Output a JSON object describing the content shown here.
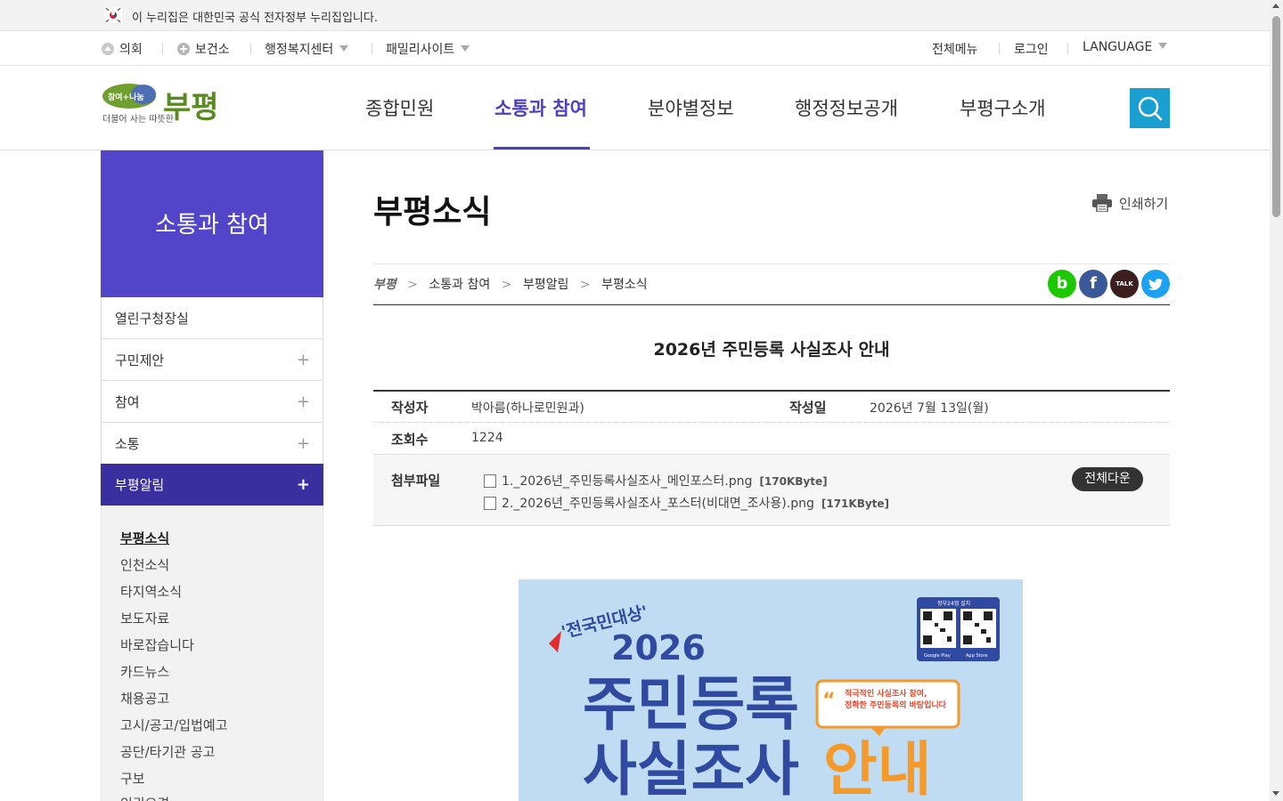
{
  "gov_banner": {
    "text": "이 누리집은 대한민국 공식 전자정부 누리집입니다."
  },
  "utility": {
    "left": [
      "의회",
      "보건소",
      "행정복지센터",
      "패밀리사이트"
    ],
    "right": [
      "전체메뉴",
      "로그인",
      "LANGUAGE"
    ]
  },
  "logo": {
    "tagline_top": "참여+나눔",
    "tagline_bottom": "더불어 사는 따뜻한",
    "name": "부평"
  },
  "gnb": [
    "종합민원",
    "소통과 참여",
    "분야별정보",
    "행정정보공개",
    "부평구소개"
  ],
  "gnb_active_index": 1,
  "sidebar": {
    "title": "소통과 참여",
    "items": [
      "열린구청장실",
      "구민제안",
      "참여",
      "소통",
      "부평알림"
    ],
    "plus": "+",
    "active": "부평알림",
    "sub_items": [
      "부평소식",
      "인천소식",
      "타지역소식",
      "보도자료",
      "바로잡습니다",
      "카드뉴스",
      "채용공고",
      "고시/공고/입법예고",
      "공단/타기관 공고",
      "구보",
      "인권오경"
    ],
    "sub_current": "부평소식"
  },
  "content": {
    "page_title": "부평소식",
    "print_label": "인쇄하기",
    "breadcrumb": [
      "소통과 참여",
      "부평알림",
      "부평소식"
    ],
    "breadcrumb_home": "부평",
    "sns": {
      "band": "b",
      "facebook": "f",
      "kakao": "TALK"
    },
    "post_title": "2026년 주민등록 사실조사 안내",
    "author_label": "작성자",
    "author": "박아름(하나로민원과)",
    "date_label": "작성일",
    "date": "2026년 7월 13일(월)",
    "views_label": "조회수",
    "views": "1224",
    "attach_label": "첨부파일",
    "files": [
      {
        "name": "1._2026년_주민등록사실조사_메인포스터.png",
        "size": "[170KByte]"
      },
      {
        "name": "2._2026년_주민등록사실조사_포스터(비대면_조사용).png",
        "size": "[171KByte]"
      }
    ],
    "download_all": "전체다운"
  },
  "poster": {
    "badge": "'전국민대상'",
    "year": "2026",
    "line1": "주민등록",
    "line2a": "사실조사",
    "line2b": "안내",
    "bubble_line1": "적극적인 사실조사 참여,",
    "bubble_line2": "정확한 주민등록의 바탕입니다",
    "qr_header": "정부24앱 설치",
    "store1": "Google Play",
    "store2": "App Store"
  },
  "colors": {
    "brand_purple": "#5245c9",
    "active_purple": "#3a2f9e",
    "search_blue": "#1a9fd1",
    "poster_bg": "#bfdcf2",
    "poster_navy": "#2f4aa0",
    "poster_orange": "#f39a2b"
  }
}
